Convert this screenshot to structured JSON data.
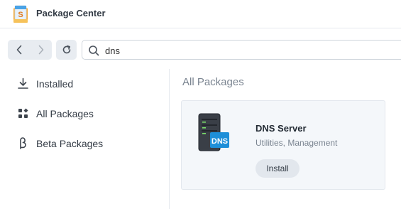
{
  "window": {
    "title": "Package Center"
  },
  "toolbar": {
    "search": {
      "value": "dns",
      "placeholder": ""
    }
  },
  "sidebar": {
    "items": [
      {
        "label": "Installed",
        "icon": "download-icon"
      },
      {
        "label": "All Packages",
        "icon": "grid-icon"
      },
      {
        "label": "Beta Packages",
        "icon": "beta-icon"
      }
    ]
  },
  "main": {
    "section_title": "All Packages",
    "packages": [
      {
        "name": "DNS Server",
        "category": "Utilities, Management",
        "action_label": "Install",
        "icon_text": "DNS",
        "icon": "dns-server-icon"
      }
    ]
  },
  "colors": {
    "accent": "#1e8fd8",
    "icon_dark": "#3a3f47"
  }
}
